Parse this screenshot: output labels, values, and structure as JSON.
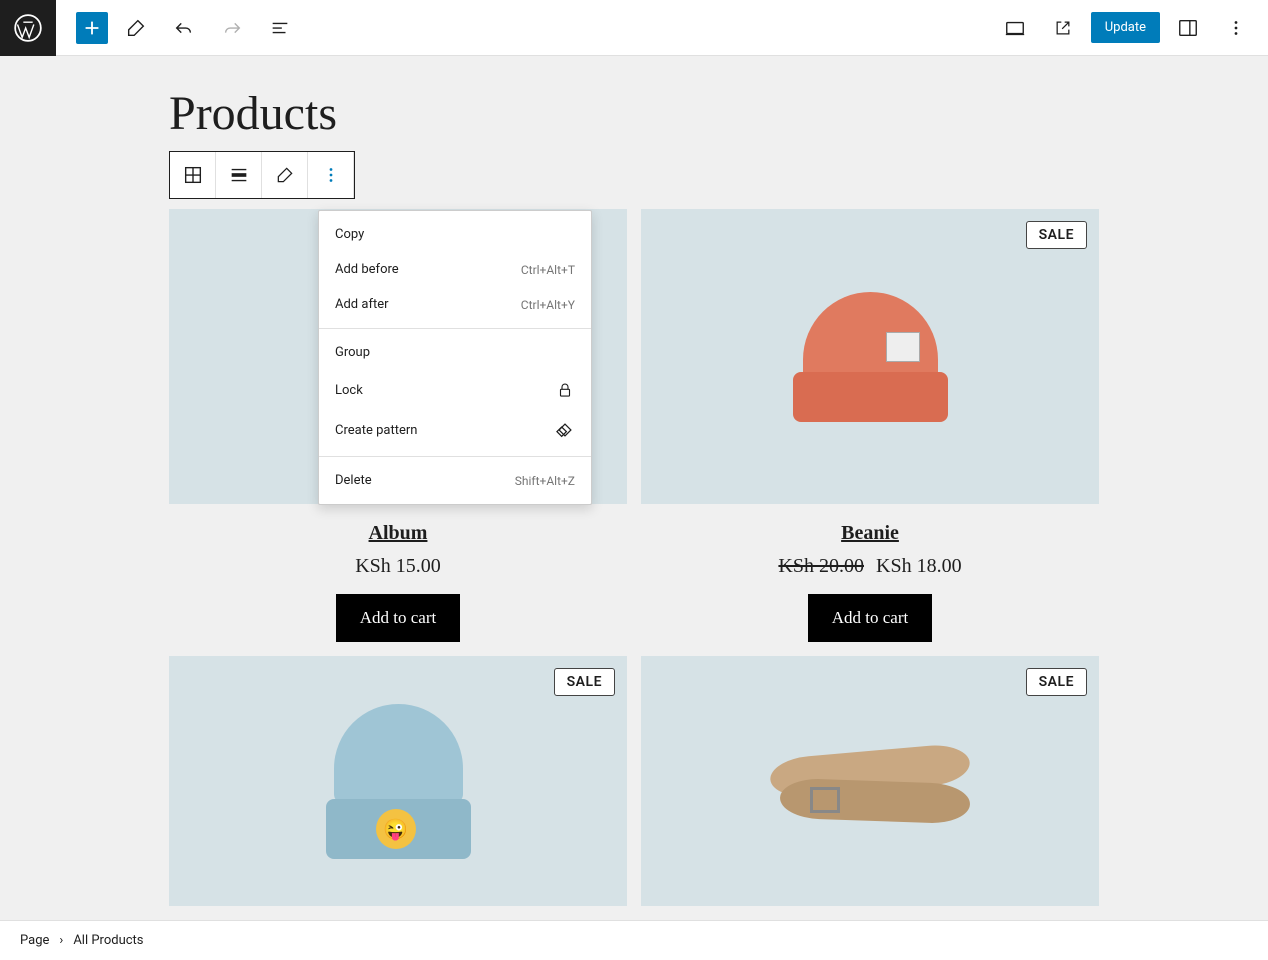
{
  "topbar": {
    "update_label": "Update"
  },
  "page": {
    "title": "Products"
  },
  "dropdown": {
    "copy": "Copy",
    "add_before": "Add before",
    "add_before_shortcut": "Ctrl+Alt+T",
    "add_after": "Add after",
    "add_after_shortcut": "Ctrl+Alt+Y",
    "group": "Group",
    "lock": "Lock",
    "create_pattern": "Create pattern",
    "delete": "Delete",
    "delete_shortcut": "Shift+Alt+Z"
  },
  "products": [
    {
      "name": "Album",
      "price": "KSh 15.00",
      "old_price": "",
      "sale": false,
      "cta": "Add to cart"
    },
    {
      "name": "Beanie",
      "price": "KSh 18.00",
      "old_price": "KSh 20.00",
      "sale": true,
      "cta": "Add to cart"
    },
    {
      "name": "",
      "price": "",
      "old_price": "",
      "sale": true,
      "cta": ""
    },
    {
      "name": "",
      "price": "",
      "old_price": "",
      "sale": true,
      "cta": ""
    }
  ],
  "sale_label": "SALE",
  "breadcrumb": {
    "root": "Page",
    "current": "All Products"
  }
}
